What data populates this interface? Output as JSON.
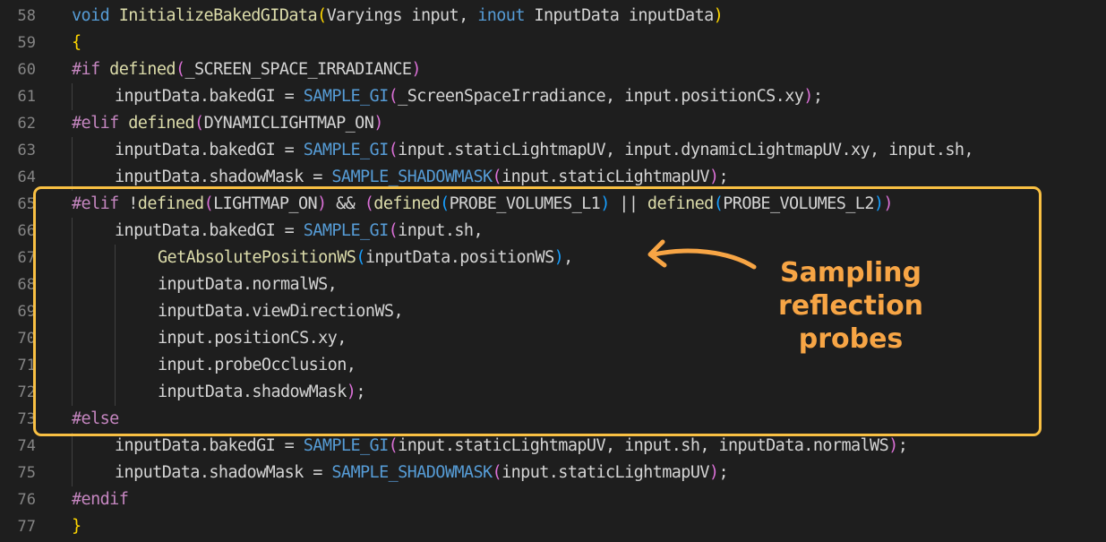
{
  "editor": {
    "lines": [
      {
        "num": "58",
        "indent": 0,
        "tokens": [
          {
            "t": "void ",
            "c": "kw"
          },
          {
            "t": "InitializeBakedGIData",
            "c": "fn"
          },
          {
            "t": "(",
            "c": "brk1"
          },
          {
            "t": "Varyings ",
            "c": "txt"
          },
          {
            "t": "input",
            "c": "txt"
          },
          {
            "t": ", ",
            "c": "txt"
          },
          {
            "t": "inout ",
            "c": "kw"
          },
          {
            "t": "InputData ",
            "c": "txt"
          },
          {
            "t": "inputData",
            "c": "txt"
          },
          {
            "t": ")",
            "c": "brk1"
          }
        ]
      },
      {
        "num": "59",
        "indent": 0,
        "tokens": [
          {
            "t": "{",
            "c": "brk1"
          }
        ]
      },
      {
        "num": "60",
        "indent": 0,
        "tokens": [
          {
            "t": "#if ",
            "c": "pre"
          },
          {
            "t": "defined",
            "c": "def"
          },
          {
            "t": "(",
            "c": "brk2"
          },
          {
            "t": "_SCREEN_SPACE_IRRADIANCE",
            "c": "txt"
          },
          {
            "t": ")",
            "c": "brk2"
          }
        ]
      },
      {
        "num": "61",
        "indent": 1,
        "tokens": [
          {
            "t": "inputData",
            "c": "txt"
          },
          {
            "t": ".bakedGI = ",
            "c": "txt"
          },
          {
            "t": "SAMPLE_GI",
            "c": "mac"
          },
          {
            "t": "(",
            "c": "brk2"
          },
          {
            "t": "_ScreenSpaceIrradiance, input.positionCS.xy",
            "c": "txt"
          },
          {
            "t": ")",
            "c": "brk2"
          },
          {
            "t": ";",
            "c": "txt"
          }
        ]
      },
      {
        "num": "62",
        "indent": 0,
        "tokens": [
          {
            "t": "#elif ",
            "c": "pre"
          },
          {
            "t": "defined",
            "c": "def"
          },
          {
            "t": "(",
            "c": "brk2"
          },
          {
            "t": "DYNAMICLIGHTMAP_ON",
            "c": "txt"
          },
          {
            "t": ")",
            "c": "brk2"
          }
        ]
      },
      {
        "num": "63",
        "indent": 1,
        "tokens": [
          {
            "t": "inputData.bakedGI = ",
            "c": "txt"
          },
          {
            "t": "SAMPLE_GI",
            "c": "mac"
          },
          {
            "t": "(",
            "c": "brk2"
          },
          {
            "t": "input.staticLightmapUV, input.dynamicLightmapUV.xy, input.sh,",
            "c": "txt"
          }
        ]
      },
      {
        "num": "64",
        "indent": 1,
        "tokens": [
          {
            "t": "inputData.shadowMask = ",
            "c": "txt"
          },
          {
            "t": "SAMPLE_SHADOWMASK",
            "c": "mac"
          },
          {
            "t": "(",
            "c": "brk2"
          },
          {
            "t": "input.staticLightmapUV",
            "c": "txt"
          },
          {
            "t": ")",
            "c": "brk2"
          },
          {
            "t": ";",
            "c": "txt"
          }
        ]
      },
      {
        "num": "65",
        "indent": 0,
        "tokens": [
          {
            "t": "#elif ",
            "c": "pre"
          },
          {
            "t": "!",
            "c": "txt"
          },
          {
            "t": "defined",
            "c": "def"
          },
          {
            "t": "(",
            "c": "brk2"
          },
          {
            "t": "LIGHTMAP_ON",
            "c": "txt"
          },
          {
            "t": ")",
            "c": "brk2"
          },
          {
            "t": " && ",
            "c": "txt"
          },
          {
            "t": "(",
            "c": "brk2"
          },
          {
            "t": "defined",
            "c": "def"
          },
          {
            "t": "(",
            "c": "brk3"
          },
          {
            "t": "PROBE_VOLUMES_L1",
            "c": "txt"
          },
          {
            "t": ")",
            "c": "brk3"
          },
          {
            "t": " || ",
            "c": "txt"
          },
          {
            "t": "defined",
            "c": "def"
          },
          {
            "t": "(",
            "c": "brk3"
          },
          {
            "t": "PROBE_VOLUMES_L2",
            "c": "txt"
          },
          {
            "t": ")",
            "c": "brk3"
          },
          {
            "t": ")",
            "c": "brk2"
          }
        ]
      },
      {
        "num": "66",
        "indent": 1,
        "tokens": [
          {
            "t": "inputData.bakedGI = ",
            "c": "txt"
          },
          {
            "t": "SAMPLE_GI",
            "c": "mac"
          },
          {
            "t": "(",
            "c": "brk2"
          },
          {
            "t": "input.sh,",
            "c": "txt"
          }
        ]
      },
      {
        "num": "67",
        "indent": 2,
        "tokens": [
          {
            "t": "GetAbsolutePositionWS",
            "c": "fn"
          },
          {
            "t": "(",
            "c": "brk3"
          },
          {
            "t": "inputData.positionWS",
            "c": "txt"
          },
          {
            "t": ")",
            "c": "brk3"
          },
          {
            "t": ",",
            "c": "txt"
          }
        ]
      },
      {
        "num": "68",
        "indent": 2,
        "tokens": [
          {
            "t": "inputData.normalWS,",
            "c": "txt"
          }
        ]
      },
      {
        "num": "69",
        "indent": 2,
        "tokens": [
          {
            "t": "inputData.viewDirectionWS,",
            "c": "txt"
          }
        ]
      },
      {
        "num": "70",
        "indent": 2,
        "tokens": [
          {
            "t": "input.positionCS.xy,",
            "c": "txt"
          }
        ]
      },
      {
        "num": "71",
        "indent": 2,
        "tokens": [
          {
            "t": "input.probeOcclusion,",
            "c": "txt"
          }
        ]
      },
      {
        "num": "72",
        "indent": 2,
        "tokens": [
          {
            "t": "inputData.shadowMask",
            "c": "txt"
          },
          {
            "t": ")",
            "c": "brk2"
          },
          {
            "t": ";",
            "c": "txt"
          }
        ]
      },
      {
        "num": "73",
        "indent": 0,
        "tokens": [
          {
            "t": "#else",
            "c": "pre"
          }
        ]
      },
      {
        "num": "74",
        "indent": 1,
        "tokens": [
          {
            "t": "inputData.bakedGI = ",
            "c": "txt"
          },
          {
            "t": "SAMPLE_GI",
            "c": "mac"
          },
          {
            "t": "(",
            "c": "brk2"
          },
          {
            "t": "input.staticLightmapUV, input.sh, inputData.normalWS",
            "c": "txt"
          },
          {
            "t": ")",
            "c": "brk2"
          },
          {
            "t": ";",
            "c": "txt"
          }
        ]
      },
      {
        "num": "75",
        "indent": 1,
        "tokens": [
          {
            "t": "inputData.shadowMask = ",
            "c": "txt"
          },
          {
            "t": "SAMPLE_SHADOWMASK",
            "c": "mac"
          },
          {
            "t": "(",
            "c": "brk2"
          },
          {
            "t": "input.staticLightmapUV",
            "c": "txt"
          },
          {
            "t": ")",
            "c": "brk2"
          },
          {
            "t": ";",
            "c": "txt"
          }
        ]
      },
      {
        "num": "76",
        "indent": 0,
        "tokens": [
          {
            "t": "#endif",
            "c": "pre"
          }
        ]
      },
      {
        "num": "77",
        "indent": 0,
        "tokens": [
          {
            "t": "}",
            "c": "brk1"
          }
        ]
      }
    ]
  },
  "annotation": {
    "line1": "Sampling",
    "line2": "reflection",
    "line3": "probes",
    "color": "#f7a545",
    "box_color": "#f9c043"
  }
}
